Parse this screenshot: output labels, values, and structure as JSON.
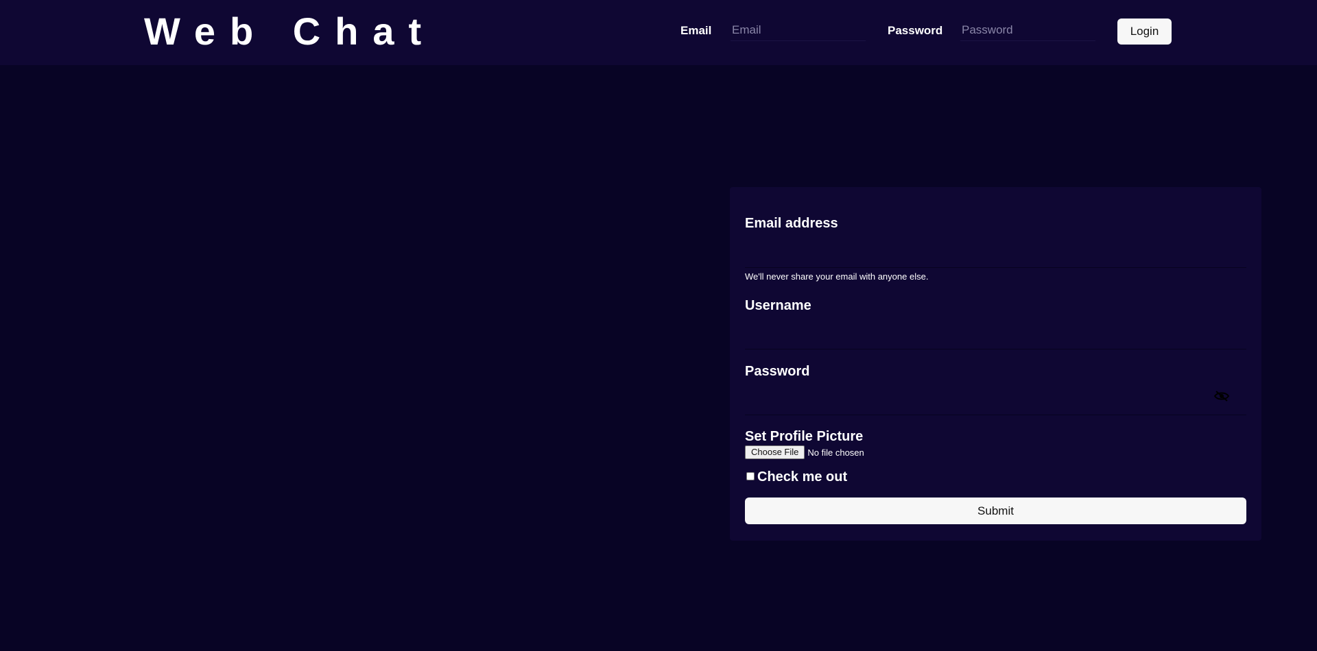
{
  "header": {
    "brand": "Web Chat",
    "email_label": "Email",
    "email_placeholder": "Email",
    "password_label": "Password",
    "password_placeholder": "Password",
    "login_label": "Login"
  },
  "signup_form": {
    "email_label": "Email address",
    "email_value": "",
    "email_help": "We'll never share your email with anyone else.",
    "username_label": "Username",
    "username_value": "",
    "password_label": "Password",
    "password_value": "",
    "password_toggle_icon": "eye-slash-icon",
    "profile_picture_label": "Set Profile Picture",
    "choose_file_label": "Choose File",
    "file_status": "No file chosen",
    "checkbox_label": "Check me out",
    "checkbox_checked": false,
    "submit_label": "Submit"
  },
  "colors": {
    "page_background": "#080425",
    "panel_background": "#0f0733",
    "button_background": "#f7f7f7"
  }
}
